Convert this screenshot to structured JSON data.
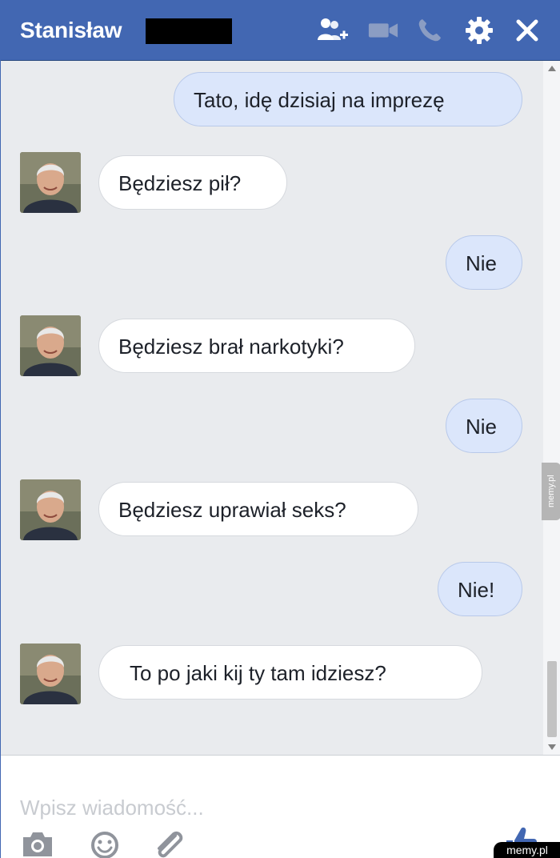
{
  "header": {
    "name": "Stanisław",
    "icons": [
      "add-people-icon",
      "video-call-icon",
      "phone-call-icon",
      "settings-icon",
      "close-icon"
    ],
    "color": "#4267b2"
  },
  "messages": [
    {
      "side": "out",
      "text": "Tato, idę dzisiaj na imprezę"
    },
    {
      "side": "in",
      "text": "Będziesz pił?"
    },
    {
      "side": "out",
      "text": "Nie"
    },
    {
      "side": "in",
      "text": "Będziesz brał narkotyki?"
    },
    {
      "side": "out",
      "text": "Nie"
    },
    {
      "side": "in",
      "text": "Będziesz uprawiał seks?"
    },
    {
      "side": "out",
      "text": "Nie!"
    },
    {
      "side": "in",
      "text": "To po jaki kij ty tam idziesz?"
    }
  ],
  "composer": {
    "placeholder": "Wpisz wiadomość...",
    "tools": [
      "camera-icon",
      "emoji-icon",
      "paperclip-icon",
      "thumbs-up-icon"
    ]
  },
  "watermark": {
    "side": "memy.pl",
    "bottom": "memy.pl"
  },
  "colors": {
    "outgoing_bubble": "#dbe6fb",
    "incoming_bubble": "#ffffff",
    "thread_background": "#e9ebee"
  }
}
